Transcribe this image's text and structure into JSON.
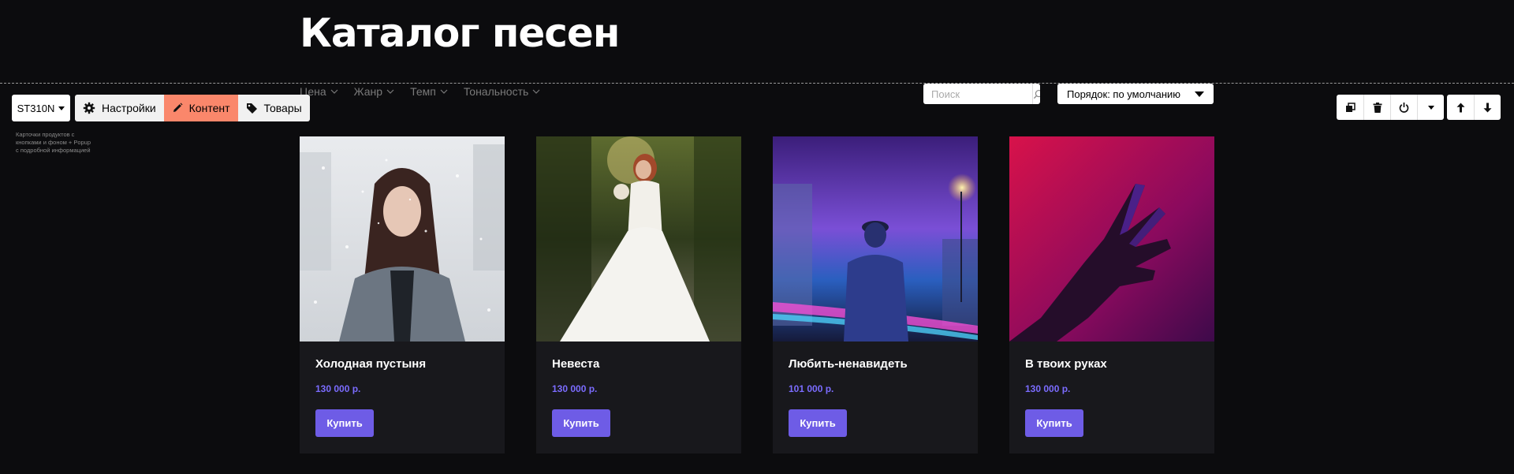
{
  "title": "Каталог песен",
  "filters": [
    {
      "label": "Цена"
    },
    {
      "label": "Жанр"
    },
    {
      "label": "Темп"
    },
    {
      "label": "Тональность"
    }
  ],
  "search": {
    "placeholder": "Поиск",
    "value": ""
  },
  "sort": {
    "label": "Порядок: по умолчанию"
  },
  "editor": {
    "block_id": "ST310N",
    "tabs": [
      {
        "label": "Настройки",
        "icon": "gear-icon",
        "active": false
      },
      {
        "label": "Контент",
        "icon": "pencil-icon",
        "active": true
      },
      {
        "label": "Товары",
        "icon": "tag-icon",
        "active": false
      }
    ],
    "description": "Карточки продуктов с кнопками и фоном + Popup с подробной информацией",
    "controls": [
      "copy-icon",
      "trash-icon",
      "power-icon",
      "chevron-down-icon",
      "arrow-up-icon",
      "arrow-down-icon"
    ],
    "accent_color": "#fa876b"
  },
  "products": [
    {
      "title": "Холодная пустыня",
      "price": "130 000 р.",
      "button": "Купить",
      "image": "woman-in-snow"
    },
    {
      "title": "Невеста",
      "price": "130 000 р.",
      "button": "Купить",
      "image": "bride-in-forest"
    },
    {
      "title": "Любить-ненавидеть",
      "price": "101 000 р.",
      "button": "Купить",
      "image": "man-in-neon-street"
    },
    {
      "title": "В твоих руках",
      "price": "130 000 р.",
      "button": "Купить",
      "image": "neon-hand"
    }
  ],
  "colors": {
    "background": "#0c0c0e",
    "card": "#18181c",
    "price": "#7b6cff",
    "button": "#6e5ce6"
  }
}
